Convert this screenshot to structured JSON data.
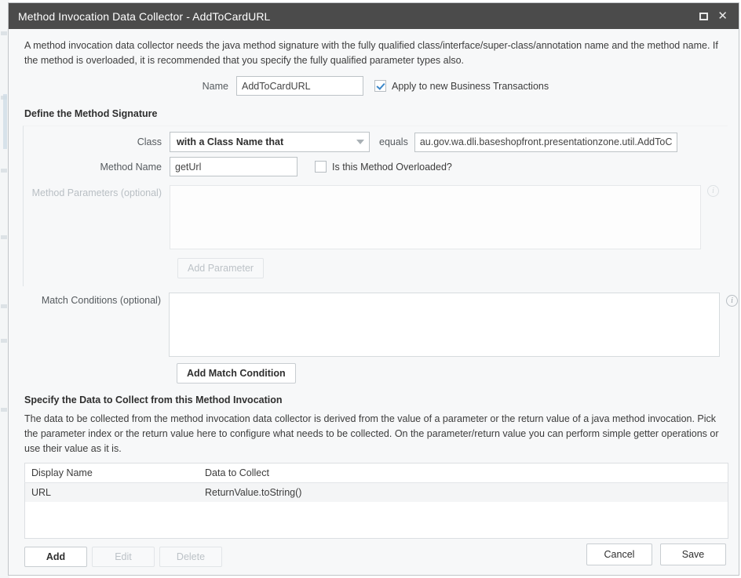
{
  "window": {
    "title": "Method Invocation Data Collector - AddToCardURL",
    "restore_icon": "restore-window-icon",
    "close_icon": "close-icon"
  },
  "intro": {
    "text": "A method invocation data collector needs the java method signature with the fully qualified class/interface/super-class/annotation name and the method name. If the method is overloaded, it is recommended that you specify the fully qualified parameter types also."
  },
  "name_field": {
    "label": "Name",
    "value": "AddToCardURL"
  },
  "apply_checkbox": {
    "label": "Apply to new Business Transactions",
    "checked": true
  },
  "signature": {
    "heading": "Define the Method Signature",
    "class": {
      "label": "Class",
      "match_type": "with a Class Name that",
      "operator": "equals",
      "value": "au.gov.wa.dli.baseshopfront.presentationzone.util.AddToCa"
    },
    "method_name": {
      "label": "Method Name",
      "value": "getUrl"
    },
    "overloaded_checkbox": {
      "label": "Is this Method Overloaded?",
      "checked": false
    },
    "method_parameters": {
      "label": "Method Parameters (optional)",
      "add_button": "Add Parameter",
      "info_icon": "info-icon",
      "items": []
    }
  },
  "match_conditions": {
    "label": "Match Conditions (optional)",
    "add_button": "Add Match Condition",
    "info_icon": "info-icon",
    "items": []
  },
  "collect": {
    "heading": "Specify the Data to Collect from this Method Invocation",
    "description": "The data to be collected from the method invocation data collector is derived from the value of a parameter or the return value of a java method invocation. Pick the parameter index or the return value here to configure what needs to be collected. On the parameter/return value you can perform simple getter operations or use their value as it is.",
    "columns": [
      "Display Name",
      "Data to Collect"
    ],
    "rows": [
      {
        "display_name": "URL",
        "data_to_collect": "ReturnValue.toString()"
      }
    ],
    "buttons": {
      "add": "Add",
      "edit": "Edit",
      "delete": "Delete"
    }
  },
  "footer": {
    "cancel": "Cancel",
    "save": "Save"
  },
  "colors": {
    "titlebar": "#4b4b4b",
    "dialog_bg": "#f7f8f9",
    "checkbox_accent": "#3b87c9",
    "text": "#3c3c3c"
  }
}
